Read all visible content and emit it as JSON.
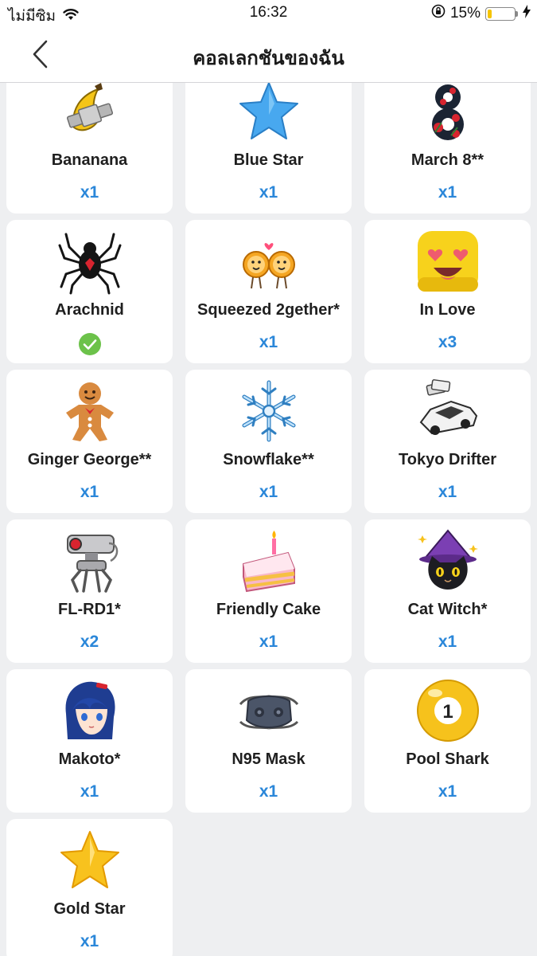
{
  "status_bar": {
    "carrier": "ไม่มีซิม",
    "time": "16:32",
    "battery_percent": "15%",
    "battery_level": 0.15
  },
  "nav": {
    "title": "คอลเลกชันของฉัน"
  },
  "colors": {
    "accent": "#2b87d9",
    "check": "#6cc24a",
    "background": "#eeeff1"
  },
  "collection": {
    "items": [
      {
        "name": "Banana",
        "label": "Bananana",
        "icon": "banana-icon",
        "count": "x1",
        "owned_check": false
      },
      {
        "name": "Blue Star",
        "label": "Blue Star",
        "icon": "blue-star-icon",
        "count": "x1",
        "owned_check": false
      },
      {
        "name": "March 8",
        "label": "March 8**",
        "icon": "march8-icon",
        "count": "x1",
        "owned_check": false
      },
      {
        "name": "Arachnid",
        "label": "Arachnid",
        "icon": "spider-icon",
        "count": "",
        "owned_check": true
      },
      {
        "name": "Squeezed 2gether",
        "label": "Squeezed 2gether*",
        "icon": "oranges-icon",
        "count": "x1",
        "owned_check": false
      },
      {
        "name": "In Love",
        "label": "In Love",
        "icon": "in-love-emoji-icon",
        "count": "x3",
        "owned_check": false
      },
      {
        "name": "Ginger George",
        "label": "Ginger George**",
        "icon": "gingerbread-icon",
        "count": "x1",
        "owned_check": false
      },
      {
        "name": "Snowflake",
        "label": "Snowflake**",
        "icon": "snowflake-icon",
        "count": "x1",
        "owned_check": false
      },
      {
        "name": "Tokyo Drifter",
        "label": "Tokyo Drifter",
        "icon": "car-icon",
        "count": "x1",
        "owned_check": false
      },
      {
        "name": "FL-RD1",
        "label": "FL-RD1*",
        "icon": "robot-icon",
        "count": "x2",
        "owned_check": false
      },
      {
        "name": "Friendly Cake",
        "label": "Friendly Cake",
        "icon": "cake-icon",
        "count": "x1",
        "owned_check": false
      },
      {
        "name": "Cat Witch",
        "label": "Cat Witch*",
        "icon": "cat-witch-icon",
        "count": "x1",
        "owned_check": false
      },
      {
        "name": "Makoto",
        "label": "Makoto*",
        "icon": "anime-girl-icon",
        "count": "x1",
        "owned_check": false
      },
      {
        "name": "N95 Mask",
        "label": "N95 Mask",
        "icon": "mask-icon",
        "count": "x1",
        "owned_check": false
      },
      {
        "name": "Pool Shark",
        "label": "Pool Shark",
        "icon": "pool-ball-icon",
        "count": "x1",
        "owned_check": false
      },
      {
        "name": "Gold Star",
        "label": "Gold Star",
        "icon": "gold-star-icon",
        "count": "x1",
        "owned_check": false
      }
    ]
  }
}
